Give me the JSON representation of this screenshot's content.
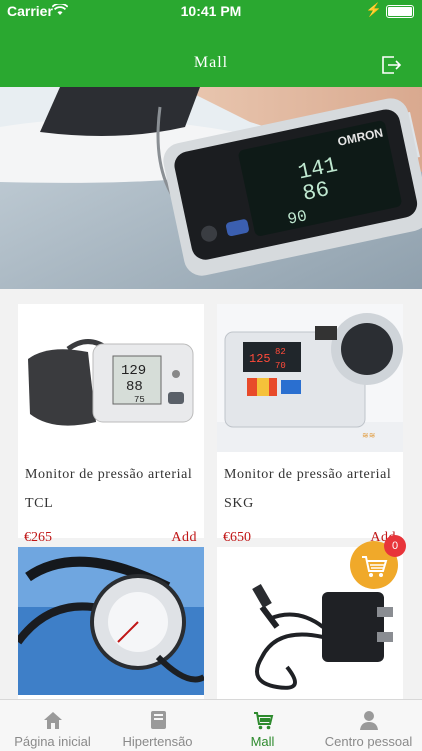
{
  "status_bar": {
    "carrier": "Carrier",
    "time": "10:41 PM"
  },
  "header": {
    "title": "Mall",
    "logout_icon": "logout-icon"
  },
  "banner": {
    "brand_text": "OMRON",
    "readings": [
      "141",
      "86",
      "90"
    ]
  },
  "products": [
    {
      "name": "Monitor de pressão arterial TCL",
      "price": "€265",
      "add_label": "Add",
      "display": [
        "129",
        "88",
        "75"
      ]
    },
    {
      "name": "Monitor de pressão arterial SKG",
      "price": "€650",
      "add_label": "Add",
      "display": [
        "125",
        "82",
        "70"
      ]
    },
    {
      "name": "",
      "price": "",
      "add_label": ""
    },
    {
      "name": "",
      "price": "",
      "add_label": ""
    }
  ],
  "cart": {
    "count": "0",
    "icon": "cart-icon",
    "color": "#f0a92a"
  },
  "tabs": [
    {
      "label": "Página inicial",
      "icon": "home-icon"
    },
    {
      "label": "Hipertensão",
      "icon": "book-icon"
    },
    {
      "label": "Mall",
      "icon": "cart-icon",
      "active": true
    },
    {
      "label": "Centro pessoal",
      "icon": "person-icon"
    }
  ],
  "colors": {
    "header": "#2aa830",
    "accent": "#2e8b2e",
    "price": "#c01616",
    "badge": "#e8343a"
  }
}
